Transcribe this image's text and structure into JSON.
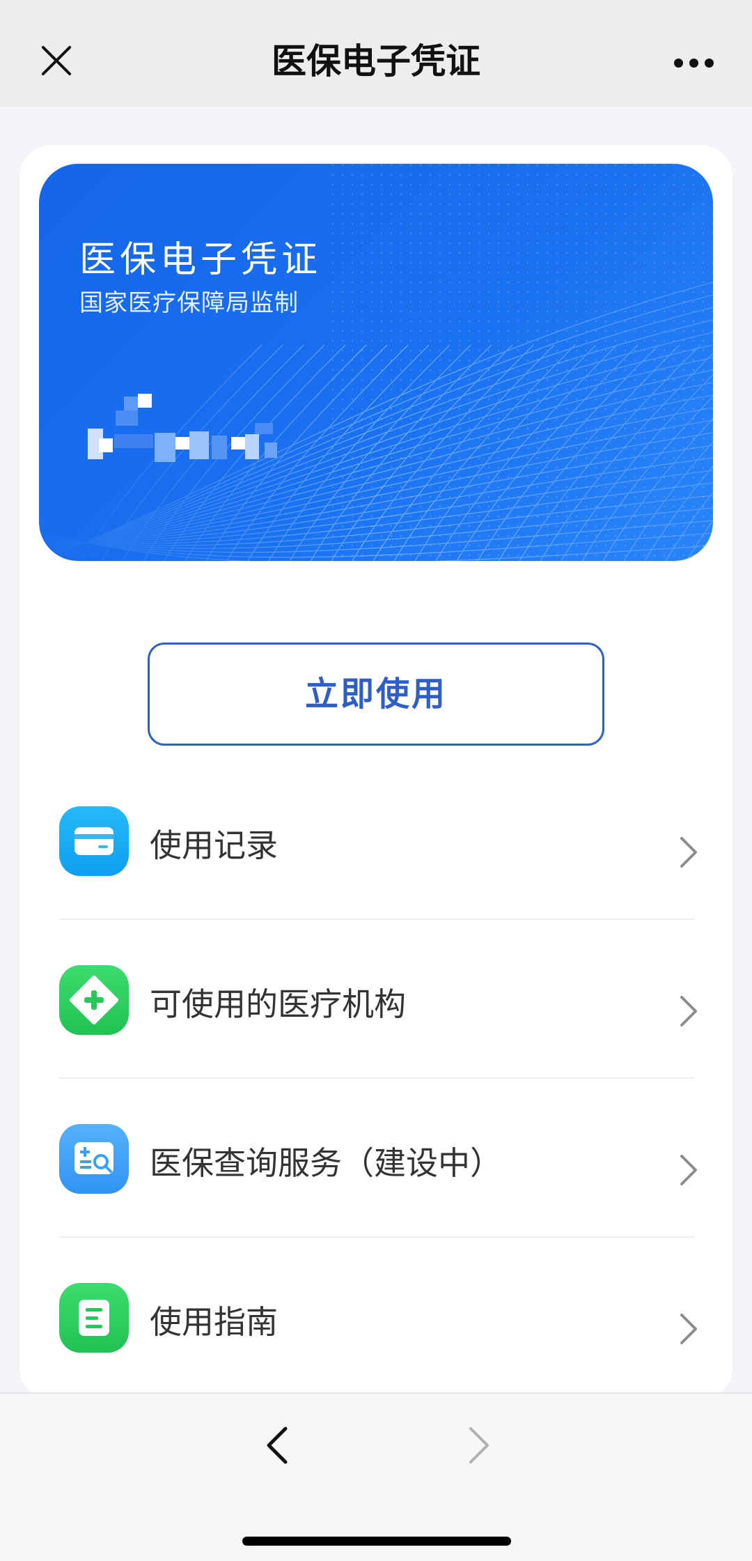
{
  "nav": {
    "title": "医保电子凭证",
    "close_icon": "close-icon",
    "more_icon": "more-dots-icon"
  },
  "card": {
    "title": "医保电子凭证",
    "subtitle": "国家医疗保障局监制",
    "background_color": "#1a6ef0"
  },
  "primary_button": {
    "label": "立即使用",
    "color": "#2f5fc6"
  },
  "menu": [
    {
      "label": "使用记录",
      "icon": "card-icon",
      "color": "#12a9f2"
    },
    {
      "label": "可使用的医疗机构",
      "icon": "medical-cross-icon",
      "color": "#2fcf5f"
    },
    {
      "label": "医保查询服务（建设中）",
      "icon": "insurance-query-icon",
      "color": "#3aa0f5"
    },
    {
      "label": "使用指南",
      "icon": "guide-icon",
      "color": "#2fcf5f"
    }
  ],
  "bottom_nav": {
    "back_icon": "chevron-left-icon",
    "forward_icon": "chevron-right-icon"
  }
}
